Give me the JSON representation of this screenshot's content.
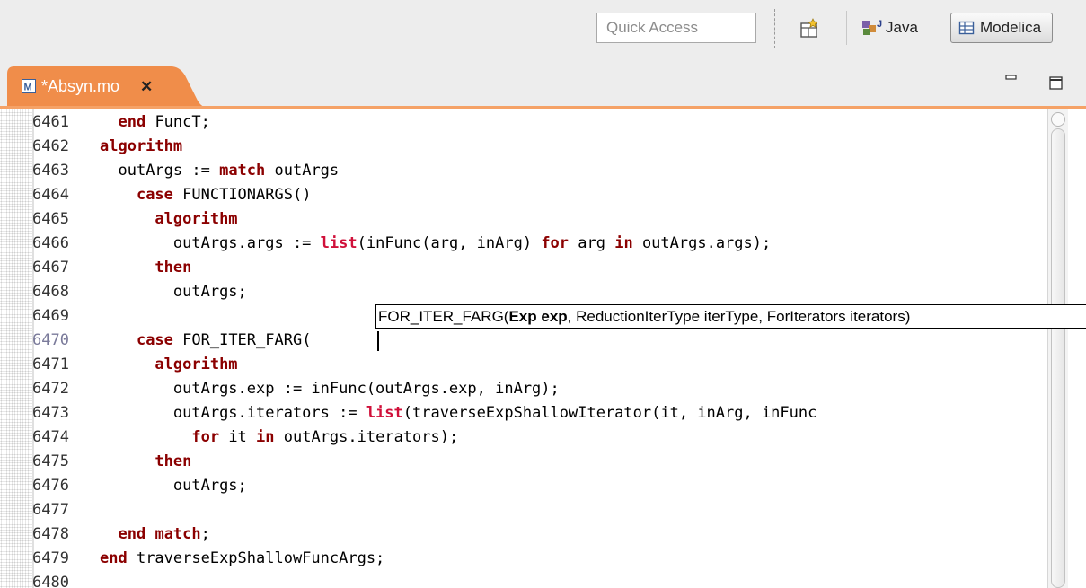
{
  "toolbar": {
    "quick_access_placeholder": "Quick Access",
    "open_perspective_icon": "open-perspective-icon",
    "java_label": "Java",
    "modelica_label": "Modelica"
  },
  "editor_tab": {
    "title": "*Absyn.mo",
    "close_symbol": "✕",
    "color": "#f08d4a"
  },
  "editor": {
    "current_line": 6470,
    "lines": [
      {
        "n": "6461",
        "indent": "  ",
        "tokens": [
          [
            "kw",
            "end"
          ],
          [
            "t",
            " FuncT;"
          ]
        ]
      },
      {
        "n": "6462",
        "indent": "",
        "tokens": [
          [
            "kw",
            "algorithm"
          ]
        ]
      },
      {
        "n": "6463",
        "indent": "  ",
        "tokens": [
          [
            "t",
            "outArgs := "
          ],
          [
            "kw",
            "match"
          ],
          [
            "t",
            " outArgs"
          ]
        ]
      },
      {
        "n": "6464",
        "indent": "    ",
        "tokens": [
          [
            "kw",
            "case"
          ],
          [
            "t",
            " FUNCTIONARGS()"
          ]
        ]
      },
      {
        "n": "6465",
        "indent": "      ",
        "tokens": [
          [
            "kw",
            "algorithm"
          ]
        ]
      },
      {
        "n": "6466",
        "indent": "        ",
        "tokens": [
          [
            "t",
            "outArgs.args := "
          ],
          [
            "bi",
            "list"
          ],
          [
            "t",
            "(inFunc(arg, inArg) "
          ],
          [
            "kw",
            "for"
          ],
          [
            "t",
            " arg "
          ],
          [
            "kw",
            "in"
          ],
          [
            "t",
            " outArgs.args);"
          ]
        ]
      },
      {
        "n": "6467",
        "indent": "      ",
        "tokens": [
          [
            "kw",
            "then"
          ]
        ]
      },
      {
        "n": "6468",
        "indent": "        ",
        "tokens": [
          [
            "t",
            "outArgs;"
          ]
        ]
      },
      {
        "n": "6469",
        "indent": "",
        "tokens": []
      },
      {
        "n": "6470",
        "indent": "    ",
        "tokens": [
          [
            "kw",
            "case"
          ],
          [
            "t",
            " FOR_ITER_FARG("
          ]
        ]
      },
      {
        "n": "6471",
        "indent": "      ",
        "tokens": [
          [
            "kw",
            "algorithm"
          ]
        ]
      },
      {
        "n": "6472",
        "indent": "        ",
        "tokens": [
          [
            "t",
            "outArgs.exp := inFunc(outArgs.exp, inArg);"
          ]
        ]
      },
      {
        "n": "6473",
        "indent": "        ",
        "tokens": [
          [
            "t",
            "outArgs.iterators := "
          ],
          [
            "bi",
            "list"
          ],
          [
            "t",
            "(traverseExpShallowIterator(it, inArg, inFunc"
          ]
        ]
      },
      {
        "n": "6474",
        "indent": "          ",
        "tokens": [
          [
            "kw",
            "for"
          ],
          [
            "t",
            " it "
          ],
          [
            "kw",
            "in"
          ],
          [
            "t",
            " outArgs.iterators);"
          ]
        ]
      },
      {
        "n": "6475",
        "indent": "      ",
        "tokens": [
          [
            "kw",
            "then"
          ]
        ]
      },
      {
        "n": "6476",
        "indent": "        ",
        "tokens": [
          [
            "t",
            "outArgs;"
          ]
        ]
      },
      {
        "n": "6477",
        "indent": "",
        "tokens": []
      },
      {
        "n": "6478",
        "indent": "  ",
        "tokens": [
          [
            "kw",
            "end"
          ],
          [
            "t",
            " "
          ],
          [
            "kw",
            "match"
          ],
          [
            "t",
            ";"
          ]
        ]
      },
      {
        "n": "6479",
        "indent": "",
        "tokens": [
          [
            "kw",
            "end"
          ],
          [
            "t",
            " traverseExpShallowFuncArgs;"
          ]
        ]
      },
      {
        "n": "6480",
        "indent": "",
        "tokens": []
      }
    ]
  },
  "content_assist": {
    "prefix": "FOR_ITER_FARG(",
    "highlight": "Exp exp",
    "rest": ", ReductionIterType iterType, ForIterators iterators)"
  },
  "colors": {
    "keyword": "#8b0000",
    "builtin": "#d0103a",
    "tab_active": "#f08d4a"
  }
}
